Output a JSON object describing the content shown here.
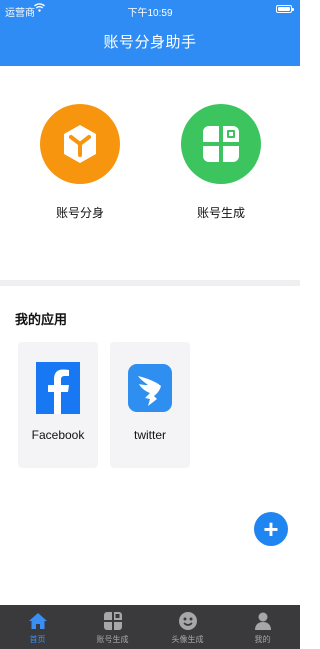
{
  "status_bar": {
    "carrier": "运营商",
    "time": "下午10:59"
  },
  "header": {
    "title": "账号分身助手"
  },
  "features": [
    {
      "label": "账号分身",
      "icon": "cube-icon",
      "color": "#f7950f"
    },
    {
      "label": "账号生成",
      "icon": "grid-icon",
      "color": "#3cc45f"
    }
  ],
  "my_apps": {
    "title": "我的应用",
    "apps": [
      {
        "label": "Facebook",
        "icon": "facebook-icon",
        "color": "#1877f2"
      },
      {
        "label": "twitter",
        "icon": "dingtalk-bird-icon",
        "color": "#2e8ff0"
      }
    ]
  },
  "fab": {
    "icon": "plus-icon",
    "symbol": "+"
  },
  "tab_bar": {
    "tabs": [
      {
        "label": "首页",
        "icon": "home-icon",
        "active": true
      },
      {
        "label": "账号生成",
        "icon": "grid-icon",
        "active": false
      },
      {
        "label": "头像生成",
        "icon": "face-icon",
        "active": false
      },
      {
        "label": "我的",
        "icon": "person-icon",
        "active": false
      }
    ]
  },
  "colors": {
    "brand": "#2f8cf5",
    "tab_bar_bg": "#3a3a3c",
    "tab_active": "#3a8ff5"
  }
}
